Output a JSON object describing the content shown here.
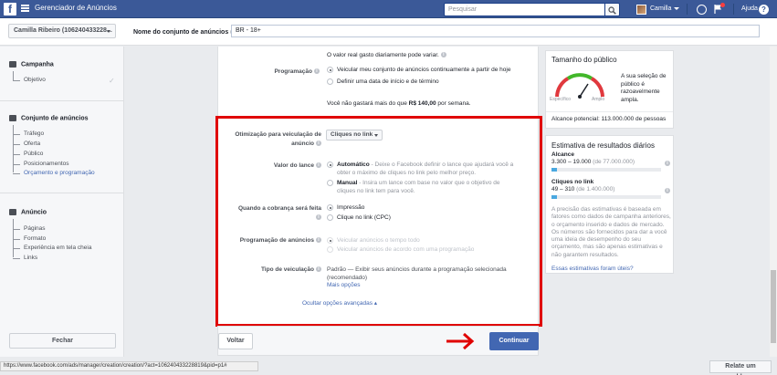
{
  "topbar": {
    "app_title": "Gerenciador de Anúncios",
    "search_placeholder": "Pesquisar",
    "user_name": "Camilla",
    "help_label": "Ajuda",
    "help_glyph": "?"
  },
  "subbar": {
    "account": "Camilla Ribeiro (106240433228...",
    "adset_name_label": "Nome do conjunto de anúncios",
    "adset_name_value": "BR - 18+"
  },
  "sidebar": {
    "campaign": {
      "title": "Campanha",
      "items": [
        "Objetivo"
      ],
      "check": "✓"
    },
    "adset": {
      "title": "Conjunto de anúncios",
      "items": [
        "Tráfego",
        "Oferta",
        "Público",
        "Posicionamentos",
        "Orçamento e programação"
      ]
    },
    "ad": {
      "title": "Anúncio",
      "items": [
        "Páginas",
        "Formato",
        "Experiência em tela cheia",
        "Links"
      ]
    },
    "close_label": "Fechar"
  },
  "main": {
    "daily_note": "O valor real gasto diariamente pode variar.",
    "schedule_label": "Programação",
    "schedule_opt1": "Veicular meu conjunto de anúncios continuamente a partir de hoje",
    "schedule_opt2": "Definir uma data de início e de término",
    "weekly_prefix": "Você não gastará mais do que ",
    "weekly_amount": "R$ 140,00",
    "weekly_suffix": " por semana.",
    "optim_label_1": "Otimização para veiculação de",
    "optim_label_2": "anúncio",
    "optim_value": "Cliques no link",
    "bid_label": "Valor do lance",
    "bid_auto_title": "Automático",
    "bid_auto_desc_1": " - Deixe o Facebook definir o lance que ajudará você a",
    "bid_auto_desc_2": "obter o máximo de cliques no link pelo melhor preço.",
    "bid_manual_title": "Manual",
    "bid_manual_desc_1": " - Insira um lance com base no valor que o objetivo de",
    "bid_manual_desc_2": "cliques no link tem para você.",
    "charge_label": "Quando a cobrança será feita",
    "charge_opt1": "Impressão",
    "charge_opt2": "Clique no link (CPC)",
    "sched_ads_label": "Programação de anúncios",
    "sched_ads_opt1": "Veicular anúncios o tempo todo",
    "sched_ads_opt2": "Veicular anúncios de acordo com uma programação",
    "delivery_label": "Tipo de veiculação",
    "delivery_text_1": "Padrão — Exibir seus anúncios durante a programação selecionada",
    "delivery_text_2": "(recomendado)",
    "more_options": "Mais opções",
    "hide_advanced": "Ocultar opções avançadas ▴",
    "back_label": "Voltar",
    "continue_label": "Continuar"
  },
  "audience": {
    "title": "Tamanho do público",
    "gauge_specific": "Específico",
    "gauge_broad": "Amplo",
    "description_1": "A sua seleção de",
    "description_2": "público é",
    "description_3": "razoavelmente",
    "description_4": "ampla.",
    "potential_reach": "Alcance potencial: 113.000.000 de pessoas"
  },
  "estimates": {
    "title": "Estimativa de resultados diários",
    "reach_label": "Alcance",
    "reach_range": "3.300 – 19.000",
    "reach_of": " (de 77.000.000)",
    "reach_fill": 0.05,
    "clicks_label": "Cliques no link",
    "clicks_range": "49 – 310",
    "clicks_of": " (de 1.400.000)",
    "clicks_fill": 0.05,
    "disclaimer": [
      "A precisão das estimativas é baseada em",
      "fatores como dados de campanha anteriores,",
      "o orçamento inserido e dados de mercado.",
      "Os números são fornecidos para dar a você",
      "uma ideia de desempenho do seu",
      "orçamento, mas são apenas estimativas e",
      "não garantem resultados."
    ],
    "useful_link": "Essas estimativas foram úteis?"
  },
  "browser": {
    "status_url": "https://www.facebook.com/ads/manager/creation/creation/?act=106240433228819&pid=p1#",
    "report_label": "Relate um problema"
  },
  "colors": {
    "brand": "#3b5998",
    "accent": "#4267b2",
    "highlight": "#e00000"
  }
}
